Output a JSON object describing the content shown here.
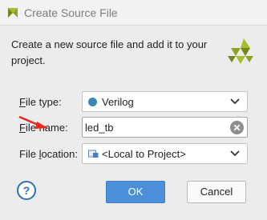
{
  "window": {
    "title": "Create Source File"
  },
  "description": "Create a new source file and add it to your project.",
  "fields": {
    "file_type": {
      "label_mnemonic": "F",
      "label_rest": "ile type:",
      "value": "Verilog"
    },
    "file_name": {
      "label_mnemonic": "F",
      "label_rest": "ile name:",
      "value": "led_tb"
    },
    "file_location": {
      "label_prefix": "File ",
      "label_mnemonic": "l",
      "label_rest": "ocation:",
      "value": "<Local to Project>"
    }
  },
  "buttons": {
    "help": "?",
    "ok": "OK",
    "cancel": "Cancel"
  },
  "colors": {
    "primary_button": "#4a8fd8",
    "help_icon": "#2f6fb5",
    "verilog_dot": "#3c87b3",
    "annotation_arrow": "#e8281c",
    "logo_yellow_green": "#a7bd2e",
    "logo_dark_green": "#6f8a1a"
  },
  "icons": {
    "app": "vivado-logo-icon",
    "brand": "vivado-logo-icon",
    "file_type": "verilog-dot-icon",
    "file_location": "folder-icon",
    "clear": "clear-icon",
    "dropdown": "chevron-down-icon",
    "annotation": "red-arrow-icon"
  }
}
